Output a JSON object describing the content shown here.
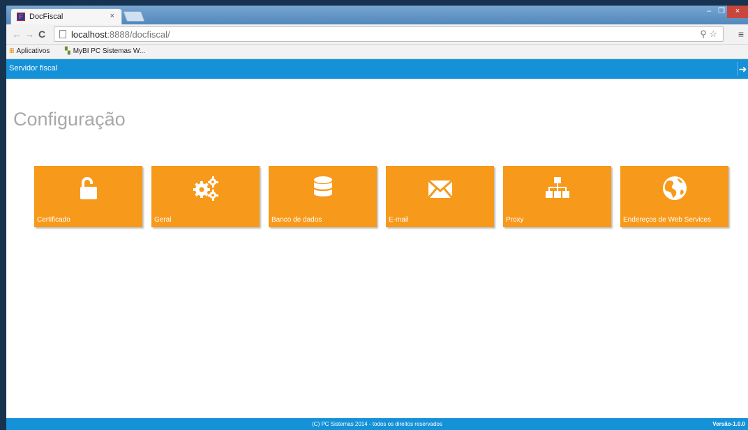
{
  "browser": {
    "tab_title": "DocFiscal",
    "tab_favicon": "F",
    "tab_close": "×",
    "window_minimize": "–",
    "window_maximize": "❐",
    "window_close": "×",
    "url_host": "localhost",
    "url_path": ":8888/docfiscal/",
    "nav_back": "←",
    "nav_forward": "→",
    "nav_reload": "C",
    "omnibox_icons": "⚲ ☆",
    "menu_glyph": "≡"
  },
  "bookmarks": {
    "apps_label": "Aplicativos",
    "apps_icon": "⁝⁝⁝",
    "mybi_label": "MyBI PC Sistemas W...",
    "mybi_icon": "▚"
  },
  "header": {
    "title": "Servidor fiscal",
    "back_glyph": "➜"
  },
  "main": {
    "title": "Configuração",
    "tiles": [
      {
        "label": "Certificado",
        "icon": "unlock-icon"
      },
      {
        "label": "Geral",
        "icon": "gears-icon"
      },
      {
        "label": "Banco de dados",
        "icon": "database-icon"
      },
      {
        "label": "E-mail",
        "icon": "envelope-icon"
      },
      {
        "label": "Proxy",
        "icon": "sitemap-icon"
      },
      {
        "label": "Endereços de Web Services",
        "icon": "globe-icon"
      }
    ]
  },
  "footer": {
    "copyright": "(C) PC Sistemas 2014 - todos os direitos reservados",
    "version": "Versão-1.0.0"
  },
  "colors": {
    "accent": "#1591d8",
    "tile": "#f7991a",
    "title": "#a8a8a8"
  }
}
